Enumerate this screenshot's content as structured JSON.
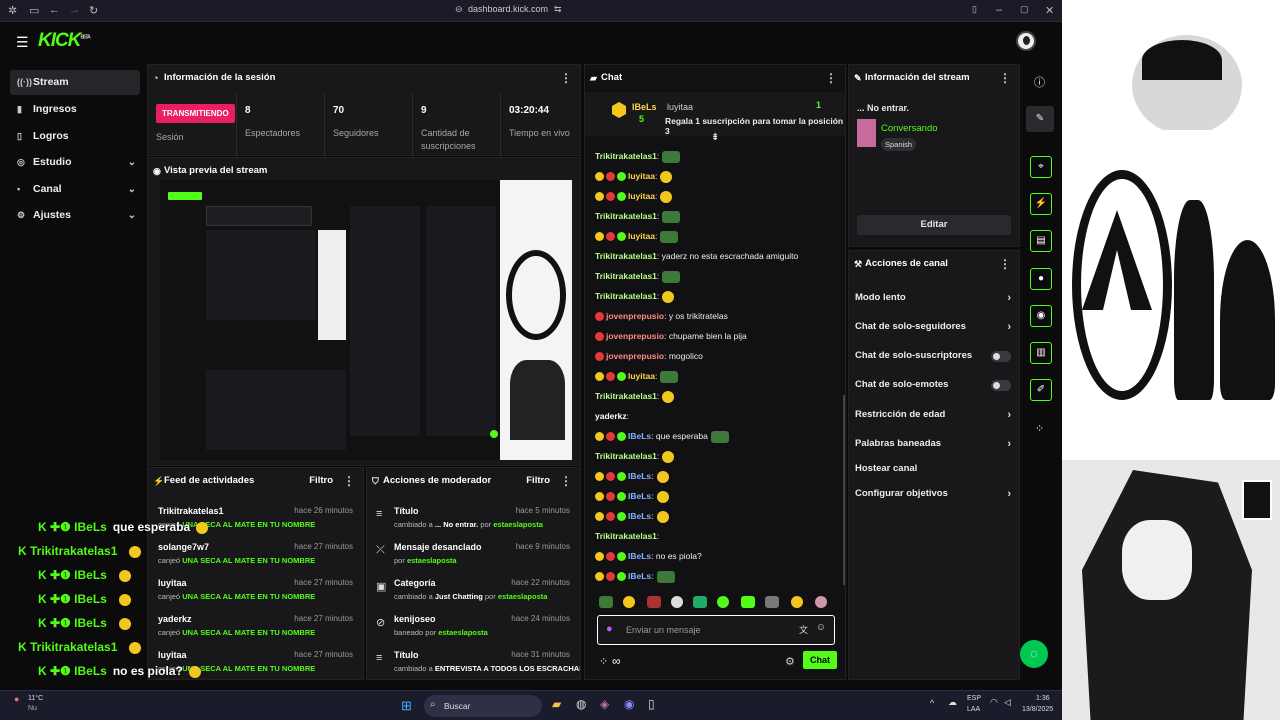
{
  "browser": {
    "url": "dashboard.kick.com"
  },
  "brand": {
    "logo": "KICK",
    "beta": "BETA",
    "accent": "#53fc18"
  },
  "sidebar": {
    "items": [
      {
        "label": "Stream",
        "icon": "broadcast-icon"
      },
      {
        "label": "Ingresos",
        "icon": "money-icon"
      },
      {
        "label": "Logros",
        "icon": "trophy-icon"
      },
      {
        "label": "Estudio",
        "icon": "studio-icon"
      },
      {
        "label": "Canal",
        "icon": "channel-icon"
      },
      {
        "label": "Ajustes",
        "icon": "gear-icon"
      }
    ]
  },
  "session": {
    "title": "Información de la sesión",
    "live": "TRANSMITIENDO",
    "live_label": "Sesión",
    "stats": [
      {
        "value": "8",
        "label": "Espectadores"
      },
      {
        "value": "70",
        "label": "Seguidores"
      },
      {
        "value": "9",
        "label": "Cantidad de suscripciones"
      },
      {
        "value": "03:20:44",
        "label": "Tiempo en vivo"
      }
    ]
  },
  "preview": {
    "title": "Vista previa del stream"
  },
  "feed": {
    "title": "Feed de actividades",
    "filter": "Filtro",
    "rows": [
      {
        "name": "Trikitrakatelas1",
        "time": "hace 26 minutos",
        "prefix": "canjeó",
        "reward": "UNA SECA AL MATE EN TU NOMBRE"
      },
      {
        "name": "solange7w7",
        "time": "hace 27 minutos",
        "prefix": "canjeó",
        "reward": "UNA SECA AL MATE EN TU NOMBRE"
      },
      {
        "name": "luyitaa",
        "time": "hace 27 minutos",
        "prefix": "canjeó",
        "reward": "UNA SECA AL MATE EN TU NOMBRE"
      },
      {
        "name": "yaderkz",
        "time": "hace 27 minutos",
        "prefix": "canjeó",
        "reward": "UNA SECA AL MATE EN TU NOMBRE"
      },
      {
        "name": "luyitaa",
        "time": "hace 27 minutos",
        "prefix": "canjeó",
        "reward": "UNA SECA AL MATE EN TU NOMBRE"
      }
    ]
  },
  "mod": {
    "title": "Acciones de moderador",
    "filter": "Filtro",
    "rows": [
      {
        "name": "Título",
        "time": "hace 5 minutos",
        "a": "cambiado a",
        "b": "... No entrar.",
        "c": "por",
        "d": "estaeslaposta",
        "icon": "title-icon"
      },
      {
        "name": "Mensaje desanclado",
        "time": "hace 9 minutos",
        "a": "por",
        "b": "estaeslaposta",
        "c": "",
        "d": "",
        "icon": "unpin-icon"
      },
      {
        "name": "Categoría",
        "time": "hace 22 minutos",
        "a": "cambiado a",
        "b": "Just Chatting",
        "c": "por",
        "d": "estaeslaposta",
        "icon": "category-icon"
      },
      {
        "name": "kenijoseo",
        "time": "hace 24 minutos",
        "a": "baneado por",
        "b": "estaeslaposta",
        "c": "",
        "d": "",
        "icon": "ban-icon"
      },
      {
        "name": "Título",
        "time": "hace 31 minutos",
        "a": "cambiado a",
        "b": "ENTREVISTA A TODOS LOS ESCRACHADOS",
        "c": "",
        "d": "",
        "icon": "title-icon"
      }
    ]
  },
  "chat": {
    "title": "Chat",
    "pinned": {
      "user1": "IBeLs",
      "count1": "5",
      "user2": "luyitaa",
      "text": "Regala 1 suscripción para tomar la posición 3",
      "count2": "1"
    },
    "messages": [
      {
        "user": "Trikitrakatelas1",
        "cls": "u-g",
        "text": ":",
        "emote": "em"
      },
      {
        "user": "luyitaa",
        "cls": "u-y",
        "text": ":",
        "emote": "ey"
      },
      {
        "user": "luyitaa",
        "cls": "u-y",
        "text": ":",
        "emote": "ey"
      },
      {
        "user": "Trikitrakatelas1",
        "cls": "u-g",
        "text": ":",
        "emote": "em"
      },
      {
        "user": "luyitaa",
        "cls": "u-y",
        "text": ":",
        "emote": "em"
      },
      {
        "user": "Trikitrakatelas1",
        "cls": "u-g",
        "text": ": yaderz no esta escrachada amiguito",
        "emote": ""
      },
      {
        "user": "Trikitrakatelas1",
        "cls": "u-g",
        "text": ":",
        "emote": "em"
      },
      {
        "user": "Trikitrakatelas1",
        "cls": "u-g",
        "text": ":",
        "emote": "ey"
      },
      {
        "user": "jovenprepusio",
        "cls": "u-r",
        "text": ": y os trikitratelas",
        "emote": ""
      },
      {
        "user": "jovenprepusio",
        "cls": "u-r",
        "text": ": chupame bien la pija",
        "emote": ""
      },
      {
        "user": "jovenprepusio",
        "cls": "u-r",
        "text": ": mogolico",
        "emote": ""
      },
      {
        "user": "luyitaa",
        "cls": "u-y",
        "text": ":",
        "emote": "em"
      },
      {
        "user": "Trikitrakatelas1",
        "cls": "u-g",
        "text": ":",
        "emote": "ey"
      },
      {
        "user": "yaderkz",
        "cls": "",
        "text": ":",
        "emote": ""
      },
      {
        "user": "IBeLs",
        "cls": "u-b",
        "text": ": que esperaba",
        "emote": "em"
      },
      {
        "user": "Trikitrakatelas1",
        "cls": "u-g",
        "text": ":",
        "emote": "ey"
      },
      {
        "user": "IBeLs",
        "cls": "u-b",
        "text": ":",
        "emote": "ey"
      },
      {
        "user": "IBeLs",
        "cls": "u-b",
        "text": ":",
        "emote": "ey"
      },
      {
        "user": "IBeLs",
        "cls": "u-b",
        "text": ":",
        "emote": "ey"
      },
      {
        "user": "Trikitrakatelas1",
        "cls": "u-g",
        "text": ":",
        "emote": ""
      },
      {
        "user": "IBeLs",
        "cls": "u-b",
        "text": ": no es piola?",
        "emote": ""
      },
      {
        "user": "IBeLs",
        "cls": "u-b",
        "text": ":",
        "emote": "em"
      }
    ],
    "input_placeholder": "Enviar un mensaje",
    "send": "Chat",
    "infinity": "∞"
  },
  "streaminfo": {
    "title": "Información del stream",
    "stream_title": "... No entrar.",
    "category": "Conversando",
    "language": "Spanish",
    "edit": "Editar"
  },
  "actions": {
    "title": "Acciones de canal",
    "rows": [
      {
        "label": "Modo lento",
        "kind": "arrow"
      },
      {
        "label": "Chat de solo-seguidores",
        "kind": "arrow"
      },
      {
        "label": "Chat de solo-suscriptores",
        "kind": "toggle"
      },
      {
        "label": "Chat de solo-emotes",
        "kind": "toggle"
      },
      {
        "label": "Restricción de edad",
        "kind": "arrow"
      },
      {
        "label": "Palabras baneadas",
        "kind": "arrow"
      },
      {
        "label": "Hostear canal",
        "kind": "none"
      },
      {
        "label": "Configurar objetivos",
        "kind": "arrow"
      }
    ]
  },
  "overlay": {
    "lines": [
      {
        "user": "IBeLs",
        "text": "que esperaba"
      },
      {
        "user": "Trikitrakatelas1",
        "text": ""
      },
      {
        "user": "IBeLs",
        "text": ""
      },
      {
        "user": "IBeLs",
        "text": ""
      },
      {
        "user": "IBeLs",
        "text": ""
      },
      {
        "user": "Trikitrakatelas1",
        "text": ""
      },
      {
        "user": "IBeLs",
        "text": "no es piola?"
      },
      {
        "user": "IBeLs",
        "text": ""
      }
    ]
  },
  "taskbar": {
    "search": "Buscar",
    "temp": "11°C",
    "weather": "Nu",
    "lang1": "ESP",
    "lang2": "LAA",
    "time": "1:36",
    "date": "13/8/2025"
  }
}
